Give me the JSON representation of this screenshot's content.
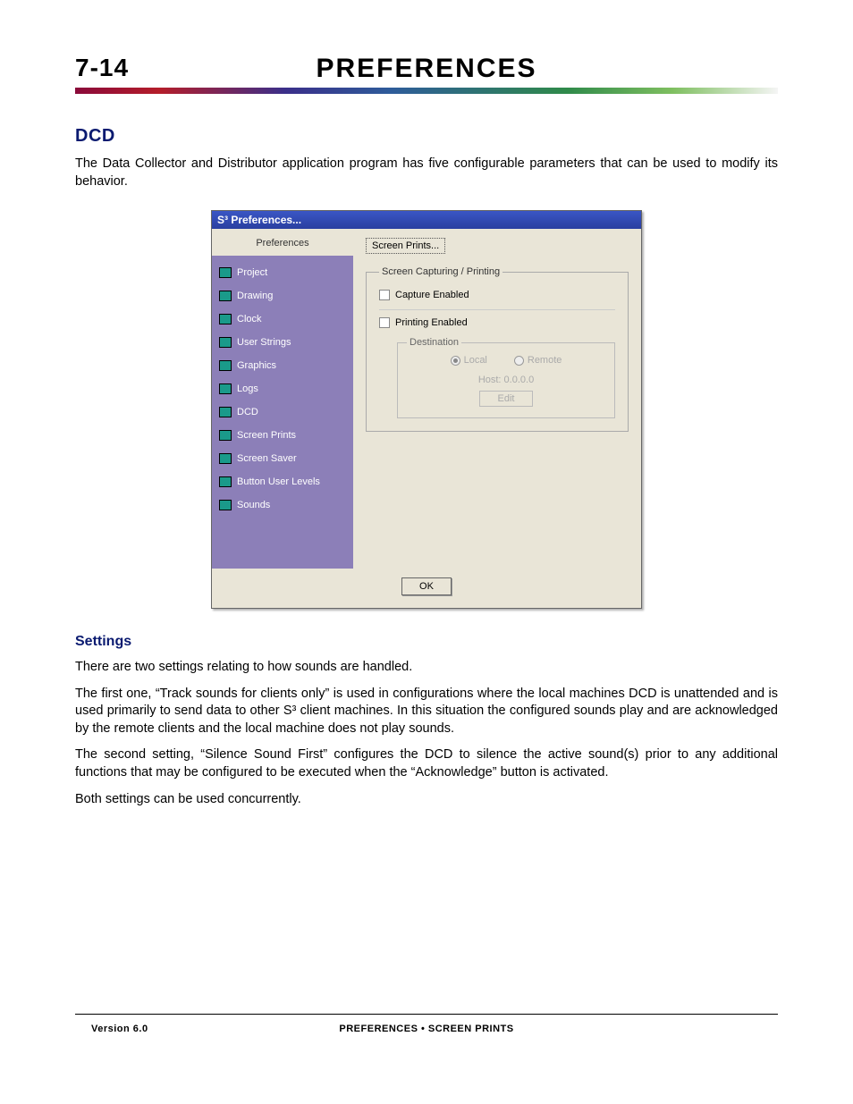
{
  "header": {
    "page_number": "7-14",
    "title": "PREFERENCES"
  },
  "section_dcd": {
    "heading": "DCD",
    "paragraph": "The Data Collector and Distributor application program has five configurable parameters that can be used to modify its behavior."
  },
  "dialog": {
    "title": "S³ Preferences...",
    "sidebar_title": "Preferences",
    "sidebar_items": [
      "Project",
      "Drawing",
      "Clock",
      "User Strings",
      "Graphics",
      "Logs",
      "DCD",
      "Screen Prints",
      "Screen Saver",
      "Button User Levels",
      "Sounds"
    ],
    "content": {
      "top_button": "Screen Prints...",
      "group_legend": "Screen Capturing / Printing",
      "capture_label": "Capture Enabled",
      "printing_label": "Printing Enabled",
      "dest_legend": "Destination",
      "radio_local": "Local",
      "radio_remote": "Remote",
      "host_text": "Host: 0.0.0.0",
      "edit_label": "Edit"
    },
    "ok_label": "OK"
  },
  "section_settings": {
    "heading": "Settings",
    "p1": "There are two settings relating to how sounds are handled.",
    "p2": "The first one, “Track sounds for clients only” is used in configurations where the local machines DCD is unattended and is used primarily to send data to other S³ client machines.  In this situation the configured sounds play and are acknowledged by the remote clients and the local machine does not play sounds.",
    "p3": "The second setting, “Silence Sound First” configures the DCD to silence the active sound(s) prior to any additional functions that may be configured to be executed when the “Acknowledge” button is activated.",
    "p4": "Both settings can be used concurrently."
  },
  "footer": {
    "version": "Version 6.0",
    "title": "PREFERENCES • SCREEN PRINTS"
  }
}
